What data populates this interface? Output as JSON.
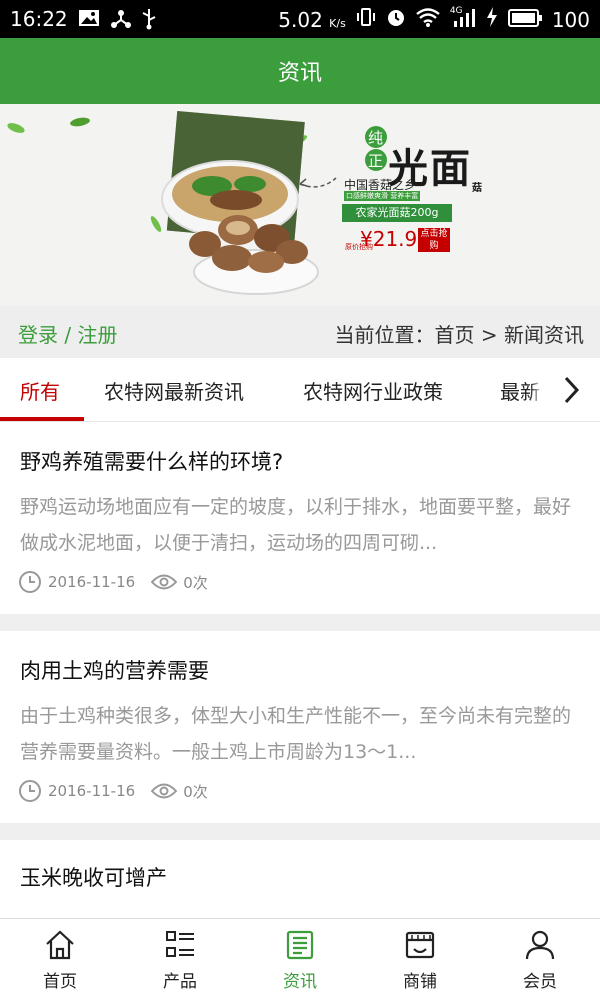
{
  "status": {
    "time": "16:22",
    "net_speed": "5.02",
    "net_unit": "K/s",
    "network": "4G",
    "battery": "100"
  },
  "header": {
    "title": "资讯"
  },
  "banner": {
    "tag_chars": "纯正",
    "big_text": "光面",
    "big_suffix": "菇",
    "origin": "中国香菇之乡",
    "sub_slogan": "口感鲜嫩爽滑 营养丰富",
    "product": "农家光面菇200g",
    "price_label": "原价抢购",
    "price": "¥21.9",
    "buy_button": "点击抢购"
  },
  "loginbar": {
    "login": "登录 / 注册",
    "breadcrumb": "当前位置：首页 > 新闻资讯"
  },
  "tabs": [
    "所有",
    "农特网最新资讯",
    "农特网行业政策",
    "最新"
  ],
  "articles": [
    {
      "title": "野鸡养殖需要什么样的环境?",
      "summary": "野鸡运动场地面应有一定的坡度，以利于排水，地面要平整，最好做成水泥地面，以便于清扫，运动场的四周可砌...",
      "date": "2016-11-16",
      "views": "0次"
    },
    {
      "title": "肉用土鸡的营养需要",
      "summary": "由于土鸡种类很多，体型大小和生产性能不一，至今尚未有完整的营养需要量资料。一般土鸡上市周龄为13～1...",
      "date": "2016-11-16",
      "views": "0次"
    },
    {
      "title": "玉米晚收可增产",
      "summary": "",
      "date": "",
      "views": ""
    }
  ],
  "nav": [
    {
      "label": "首页",
      "icon": "home-icon"
    },
    {
      "label": "产品",
      "icon": "list-icon"
    },
    {
      "label": "资讯",
      "icon": "news-icon"
    },
    {
      "label": "商铺",
      "icon": "shop-icon"
    },
    {
      "label": "会员",
      "icon": "user-icon"
    }
  ],
  "colors": {
    "primary": "#3c9d3c",
    "tab_active": "#c40000"
  }
}
